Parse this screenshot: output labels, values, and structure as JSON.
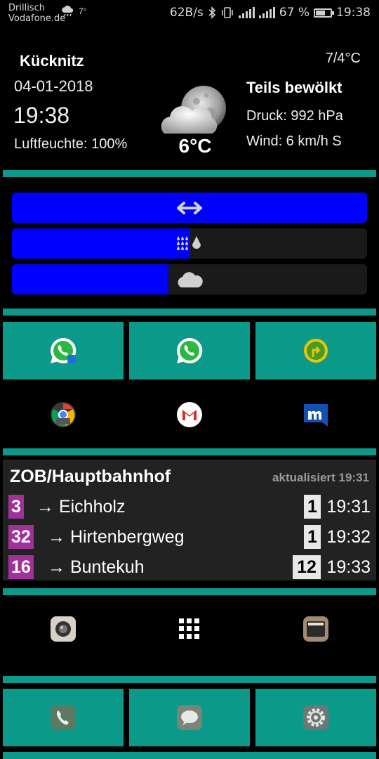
{
  "status_bar": {
    "carrier_line1": "Drillisch",
    "carrier_line2": "Vodafone.de",
    "weather_temp": "7°",
    "net_speed": "62B/s",
    "battery": "67 %",
    "battery_level": 0.67,
    "time": "19:38"
  },
  "weather": {
    "location": "Kücknitz",
    "date": "04-01-2018",
    "time": "19:38",
    "humidity": "Luftfeuchte: 100%",
    "temperature": "6°C",
    "range": "7/4°C",
    "condition": "Teils bewölkt",
    "pressure": "Druck: 992 hPa",
    "wind": "Wind: 6 km/h S"
  },
  "bars": [
    {
      "icon": "arrows-icon",
      "level": 1.0
    },
    {
      "icon": "drops-icon",
      "level": 0.5
    },
    {
      "icon": "cloud-icon",
      "level": 0.44
    }
  ],
  "transit": {
    "station": "ZOB/Hauptbahnhof",
    "updated": "aktualisiert 19:31",
    "departures": [
      {
        "line": "3",
        "dest": "→ Eichholz",
        "platform": "1",
        "time": "19:31"
      },
      {
        "line": "32",
        "dest": "→ Hirtenbergweg",
        "platform": "1",
        "time": "19:32"
      },
      {
        "line": "16",
        "dest": "→ Buntekuh",
        "platform": "12",
        "time": "19:33"
      }
    ]
  },
  "colors": {
    "accent": "#0b9a8a",
    "bar_fill": "#0000ff",
    "line_badge": "#a0309a"
  }
}
